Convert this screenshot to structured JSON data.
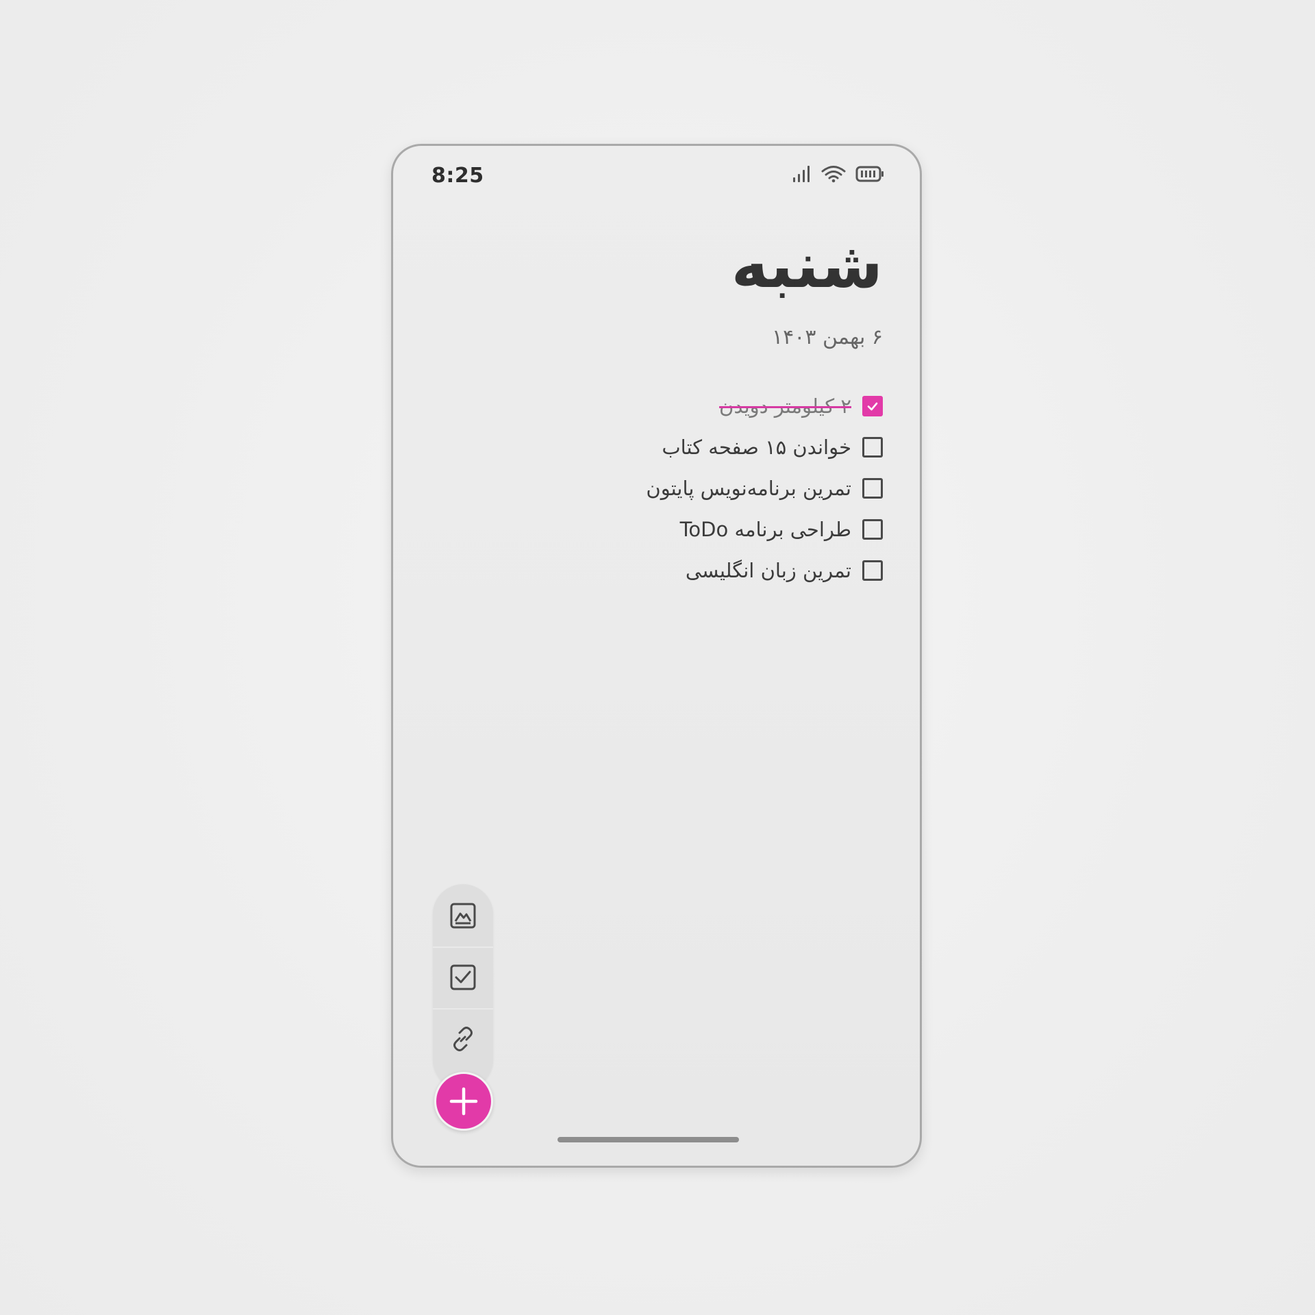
{
  "status_bar": {
    "time": "8:25",
    "icons": [
      "signal-icon",
      "wifi-icon",
      "battery-icon"
    ]
  },
  "header": {
    "day": "شنبه",
    "date": "۶ بهمن ۱۴۰۳"
  },
  "tasks": [
    {
      "label": "۲ کیلومتر دویدن",
      "done": true
    },
    {
      "label": "خواندن ۱۵ صفحه کتاب",
      "done": false
    },
    {
      "label": "تمرین برنامه‌نویس پایتون",
      "done": false
    },
    {
      "label": "طراحی برنامه ToDo",
      "done": false
    },
    {
      "label": "تمرین زبان انگلیسی",
      "done": false
    }
  ],
  "toolbar": {
    "items": [
      "image-icon",
      "checkbox-icon",
      "link-icon"
    ],
    "fab_icon": "plus-icon"
  },
  "colors": {
    "accent": "#e23aa8",
    "text_primary": "#333333",
    "text_secondary": "#666666",
    "background": "#ebebeb"
  }
}
